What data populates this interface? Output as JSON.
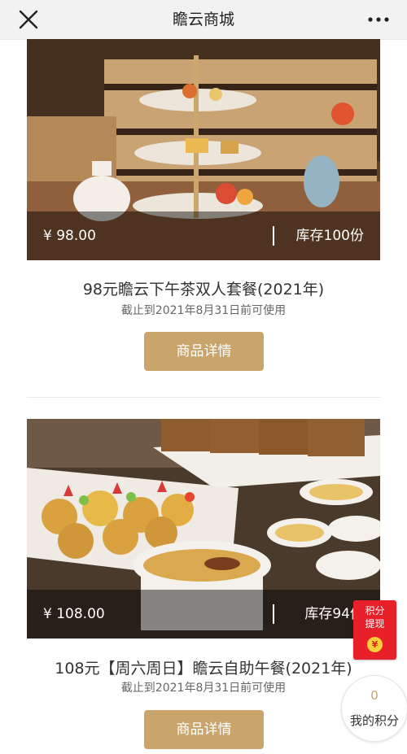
{
  "header": {
    "title": "瞻云商城",
    "close_icon": "close-icon",
    "more_icon": "more-dots-icon"
  },
  "products": [
    {
      "price": "¥ 98.00",
      "stock": "库存100份",
      "name": "98元瞻云下午茶双人套餐(2021年)",
      "validity": "截止到2021年8月31日前可使用",
      "button_label": "商品详情"
    },
    {
      "price": "¥ 108.00",
      "stock": "库存94份",
      "name": "108元【周六周日】瞻云自助午餐(2021年)",
      "validity": "截止到2021年8月31日前可使用",
      "button_label": "商品详情"
    }
  ],
  "float_redpacket": {
    "line1": "积分",
    "line2": "提现",
    "coin": "¥"
  },
  "float_points": {
    "value": "0",
    "label": "我的积分"
  },
  "colors": {
    "accent": "#c9a56b",
    "red": "#e8202a",
    "header_bg": "#f2f2f2"
  }
}
